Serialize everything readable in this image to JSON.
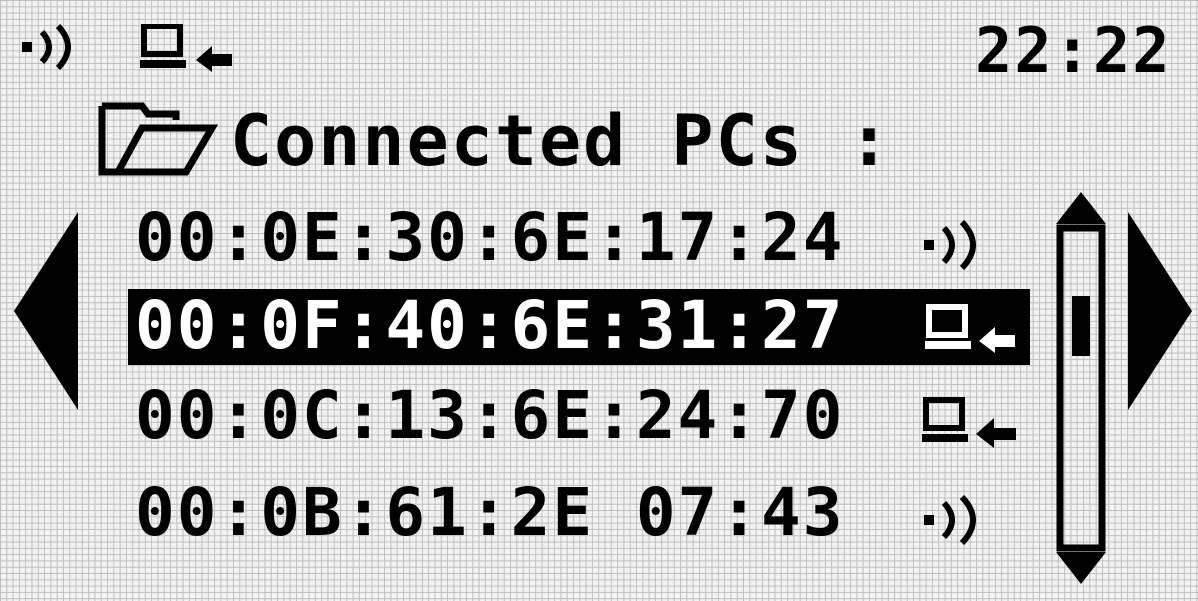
{
  "status_bar": {
    "signal_icon": "wireless-signal-icon",
    "pc_icon": "pc-connect-icon",
    "time": "22:22"
  },
  "header": {
    "folder_icon": "folder-open-icon",
    "title": "Connected PCs :"
  },
  "list": {
    "items": [
      {
        "mac": "00:0E:30:6E:17:24",
        "icon": "wireless-signal-icon",
        "selected": false
      },
      {
        "mac": "00:0F:40:6E:31:27",
        "icon": "pc-connect-icon",
        "selected": true
      },
      {
        "mac": "00:0C:13:6E:24:70",
        "icon": "pc-connect-icon",
        "selected": false
      },
      {
        "mac": "00:0B:61:2E 07:43",
        "icon": "wireless-signal-icon",
        "selected": false
      }
    ]
  },
  "scrollbar": {
    "position_fraction": 0.25
  },
  "colors": {
    "pixel_on": "#000000",
    "pixel_off": "#f2f2f2",
    "grid": "#bdbdbd"
  }
}
